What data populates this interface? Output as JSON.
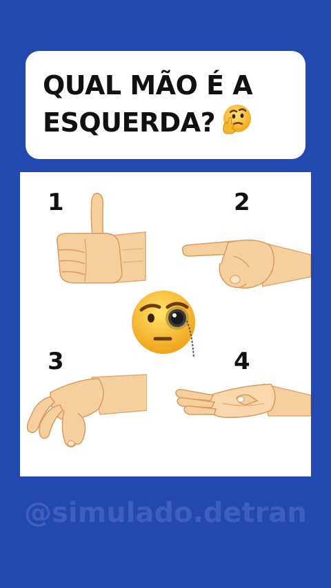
{
  "question": {
    "line1": "QUAL MÃO É A",
    "line2": "ESQUERDA?",
    "emoji_icon": "thinking-face-icon"
  },
  "options": [
    {
      "number": "1",
      "icon": "thumbs-up-hand-icon"
    },
    {
      "number": "2",
      "icon": "pointing-hand-icon"
    },
    {
      "number": "3",
      "icon": "pinching-hand-icon"
    },
    {
      "number": "4",
      "icon": "open-palm-hand-icon"
    }
  ],
  "center_emoji": "monocle-face-icon",
  "watermark": "@simulado.detran",
  "colors": {
    "background": "#2149b0",
    "card": "#ffffff",
    "skin": "#f6cf9f",
    "skin_shadow": "#e2a86f",
    "watermark": "#3a60c3"
  }
}
